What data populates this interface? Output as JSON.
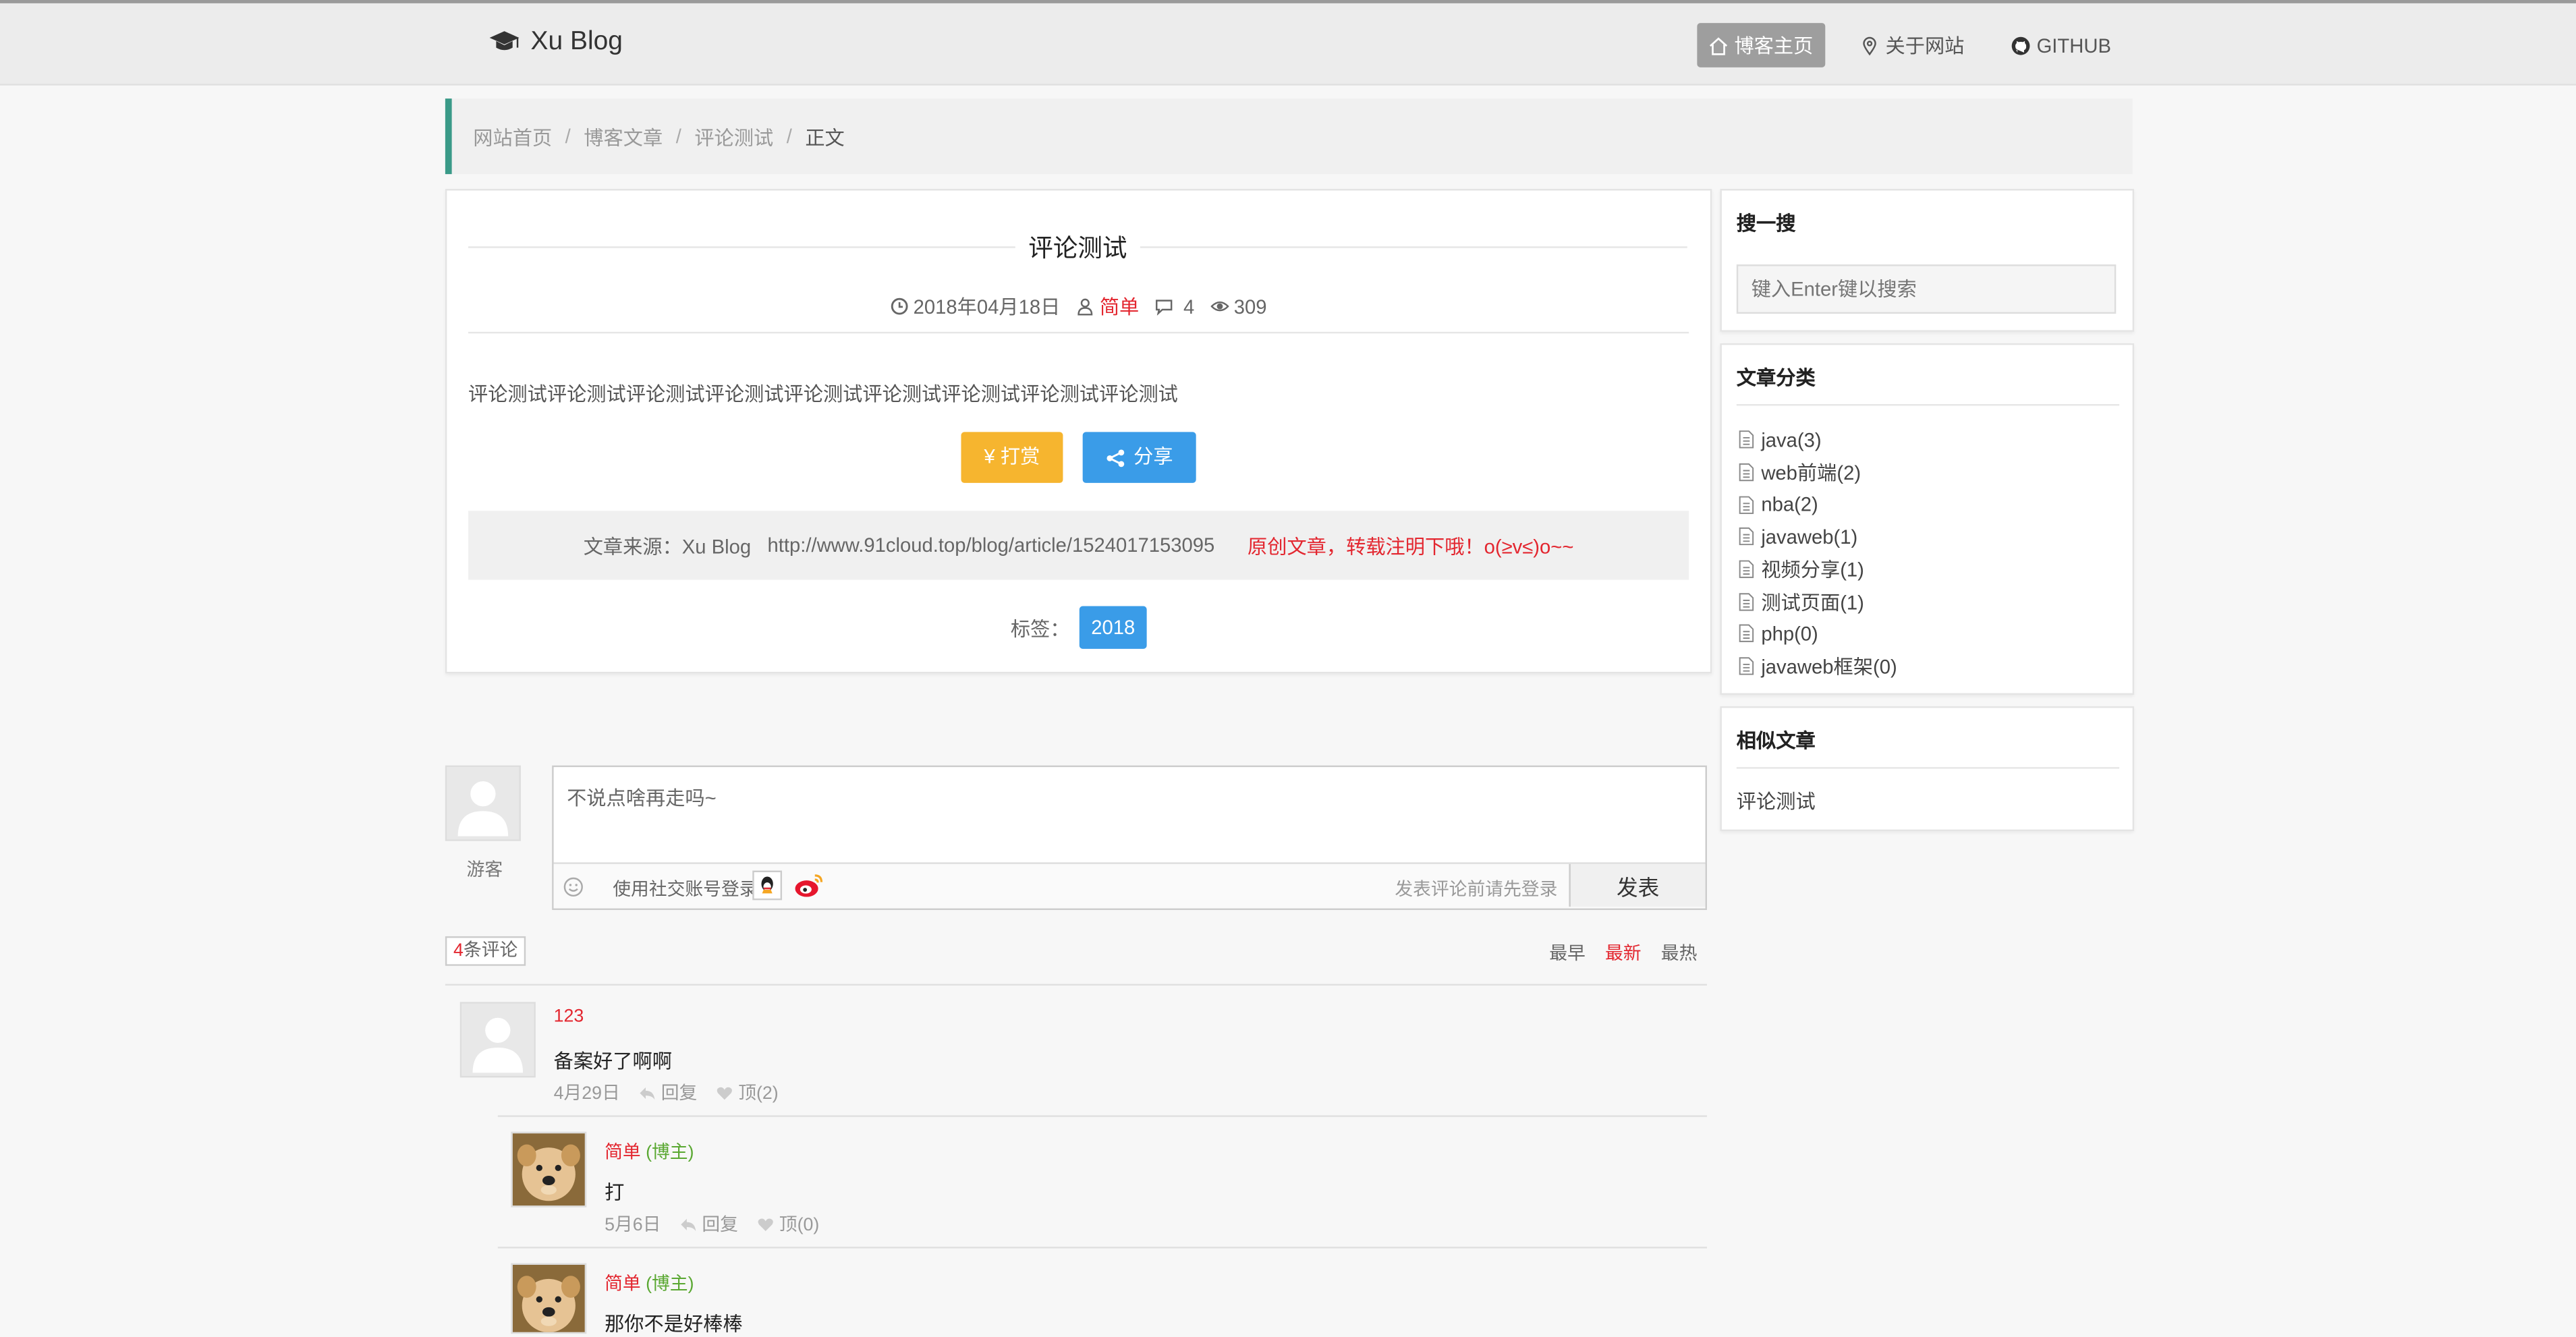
{
  "header": {
    "logo_text": "Xu Blog",
    "nav": [
      {
        "label": "博客主页",
        "icon": "home-icon",
        "active": true
      },
      {
        "label": "关于网站",
        "icon": "map-pin-icon",
        "active": false
      },
      {
        "label": "GITHUB",
        "icon": "github-icon",
        "active": false
      }
    ]
  },
  "breadcrumb": [
    "网站首页",
    "博客文章",
    "评论测试",
    "正文"
  ],
  "breadcrumb_sep": "/",
  "article": {
    "title": "评论测试",
    "date": "2018年04月18日",
    "author": "简单",
    "comments": "4",
    "views": "309",
    "body": "评论测试评论测试评论测试评论测试评论测试评论测试评论测试评论测试评论测试",
    "reward_label": "¥ 打赏",
    "share_label": "分享",
    "source_label": "文章来源：Xu Blog",
    "source_url": "http://www.91cloud.top/blog/article/1524017153095",
    "original_note": "原创文章，转载注明下哦！o(≥v≤)o~~",
    "tags_label": "标签：",
    "tags": [
      "2018"
    ]
  },
  "sidebar": {
    "search": {
      "title": "搜一搜",
      "placeholder": "键入Enter键以搜索"
    },
    "categories": {
      "title": "文章分类",
      "items": [
        "java(3)",
        "web前端(2)",
        "nba(2)",
        "javaweb(1)",
        "视频分享(1)",
        "测试页面(1)",
        "php(0)",
        "javaweb框架(0)"
      ]
    },
    "similar": {
      "title": "相似文章",
      "items": [
        "评论测试"
      ]
    }
  },
  "comment_form": {
    "guest_label": "游客",
    "placeholder": "不说点啥再走吗~",
    "social_label": "使用社交账号登录",
    "login_hint": "发表评论前请先登录",
    "submit_label": "发表"
  },
  "comments_header": {
    "count": "4",
    "count_suffix": "条评论",
    "sort": [
      {
        "label": "最早",
        "active": false
      },
      {
        "label": "最新",
        "active": true
      },
      {
        "label": "最热",
        "active": false
      }
    ]
  },
  "comments": [
    {
      "name": "123",
      "role": "",
      "text": "备案好了啊啊",
      "date": "4月29日",
      "reply": "回复",
      "like": "顶(2)",
      "avatar": "default-avatar",
      "nested": false
    },
    {
      "name": "简单",
      "role": "(博主)",
      "text": "打",
      "date": "5月6日",
      "reply": "回复",
      "like": "顶(0)",
      "avatar": "dog-avatar",
      "nested": true
    },
    {
      "name": "简单",
      "role": "(博主)",
      "text": "那你不是好棒棒",
      "date": "",
      "reply": "",
      "like": "",
      "avatar": "dog-avatar",
      "nested": true
    }
  ],
  "colors": {
    "accent_red": "#e3262f",
    "reward": "#f6b52f",
    "share": "#3a9ce8",
    "crumb_bar": "#3a9a88",
    "blogger_green": "#5aa832"
  }
}
